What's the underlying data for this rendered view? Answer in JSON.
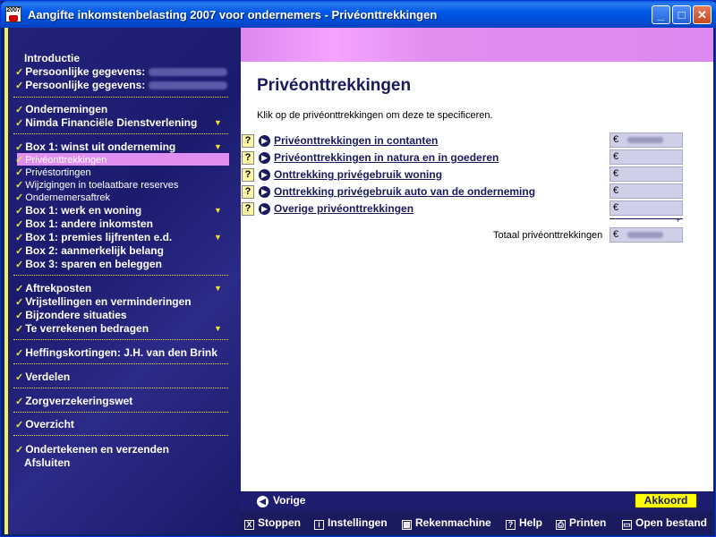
{
  "window": {
    "title": "Aangifte inkomstenbelasting 2007 voor ondernemers - Privéonttrekkingen",
    "icon_label": "2007",
    "controls": {
      "minimize": "_",
      "maximize": "□",
      "close": "✕"
    }
  },
  "sidebar": {
    "items": [
      {
        "label": "Introductie",
        "check": false
      },
      {
        "label": "Persoonlijke gegevens:",
        "check": true,
        "blurred": "J.H. van den B..."
      },
      {
        "label": "Persoonlijke gegevens:",
        "check": true,
        "blurred": "H. van den Br..."
      },
      {
        "label": "Ondernemingen",
        "check": true
      },
      {
        "label": "Nimda Financiële Dienstverlening",
        "check": true
      },
      {
        "label": "Box 1: winst uit onderneming",
        "check": true
      },
      {
        "label": "Privéonttrekkingen",
        "check": true,
        "selected": true
      },
      {
        "label": "Privéstortingen",
        "check": true
      },
      {
        "label": "Wijzigingen in toelaatbare reserves",
        "check": true
      },
      {
        "label": "Ondernemersaftrek",
        "check": true
      },
      {
        "label": "Box 1: werk en woning",
        "check": true
      },
      {
        "label": "Box 1: andere inkomsten",
        "check": true
      },
      {
        "label": "Box 1: premies lijfrenten e.d.",
        "check": true
      },
      {
        "label": "Box 2: aanmerkelijk belang",
        "check": true
      },
      {
        "label": "Box 3: sparen en beleggen",
        "check": true
      },
      {
        "label": "Aftrekposten",
        "check": true
      },
      {
        "label": "Vrijstellingen en verminderingen",
        "check": true
      },
      {
        "label": "Bijzondere situaties",
        "check": true
      },
      {
        "label": "Te verrekenen bedragen",
        "check": true
      },
      {
        "label": "Heffingskortingen: J.H. van den Brink",
        "check": true
      },
      {
        "label": "Verdelen",
        "check": true
      },
      {
        "label": "Zorgverzekeringswet",
        "check": true
      },
      {
        "label": "Overzicht",
        "check": true
      },
      {
        "label": "Ondertekenen en verzenden",
        "check": true
      },
      {
        "label": "Afsluiten",
        "check": false
      }
    ],
    "check_glyph": "✓",
    "expand_glyph": "▼"
  },
  "main": {
    "title": "Privéonttrekkingen",
    "instruction": "Klik op de privéonttrekkingen om deze te specificeren.",
    "help_glyph": "?",
    "go_glyph": "▶",
    "currency": "€",
    "rows": [
      {
        "label": "Privéonttrekkingen in contanten",
        "has_value": true
      },
      {
        "label": "Privéonttrekkingen in natura en in goederen",
        "has_value": false
      },
      {
        "label": "Onttrekking privégebruik woning",
        "has_value": false
      },
      {
        "label": "Onttrekking privégebruik auto van de onderneming",
        "has_value": false
      },
      {
        "label": "Overige privéonttrekkingen",
        "has_value": false
      }
    ],
    "sum_sign": "+",
    "total_label": "Totaal privéonttrekkingen"
  },
  "navigation": {
    "back_label": "Vorige",
    "back_glyph": "◀",
    "ok_label": "Akkoord"
  },
  "toolbar": {
    "items": [
      {
        "label": "Stoppen",
        "icon": "X"
      },
      {
        "label": "Instellingen",
        "icon": "i"
      },
      {
        "label": "Rekenmachine",
        "icon": "▦"
      },
      {
        "label": "Help",
        "icon": "?"
      },
      {
        "label": "Printen",
        "icon": "⎙"
      },
      {
        "label": "Open bestand",
        "icon": "▭"
      }
    ]
  },
  "colors": {
    "accent_yellow": "#f0e030",
    "sidebar_bg": "#1b1b6e",
    "banner": "#e08ef0",
    "ok_button": "#ffff00"
  }
}
